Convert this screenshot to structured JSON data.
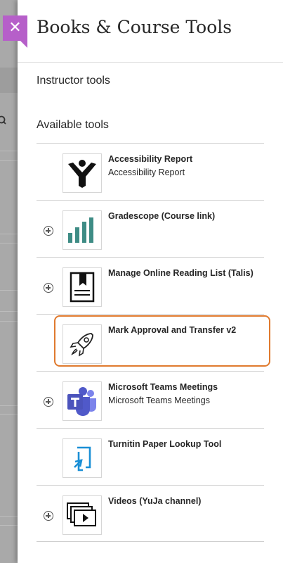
{
  "panel": {
    "title": "Books & Course Tools",
    "close_icon": "close-icon",
    "accent_color": "#b65fc9",
    "highlight_color": "#e07a2e"
  },
  "sections": {
    "instructor": "Instructor tools",
    "available": "Available tools"
  },
  "tools": [
    {
      "name": "Accessibility Report",
      "subtitle": "Accessibility Report",
      "icon": "accessibility-icon",
      "expandable": false
    },
    {
      "name": "Gradescope (Course link)",
      "subtitle": "",
      "icon": "gradescope-icon",
      "expandable": true
    },
    {
      "name": "Manage Online Reading List (Talis)",
      "subtitle": "",
      "icon": "reading-list-icon",
      "expandable": true
    },
    {
      "name": "Mark Approval and Transfer v2",
      "subtitle": "",
      "icon": "rocket-icon",
      "expandable": false,
      "highlighted": true
    },
    {
      "name": "Microsoft Teams Meetings",
      "subtitle": "Microsoft Teams Meetings",
      "icon": "teams-icon",
      "expandable": true
    },
    {
      "name": "Turnitin Paper Lookup Tool",
      "subtitle": "",
      "icon": "turnitin-icon",
      "expandable": false
    },
    {
      "name": "Videos (YuJa channel)",
      "subtitle": "",
      "icon": "video-icon",
      "expandable": true
    }
  ]
}
